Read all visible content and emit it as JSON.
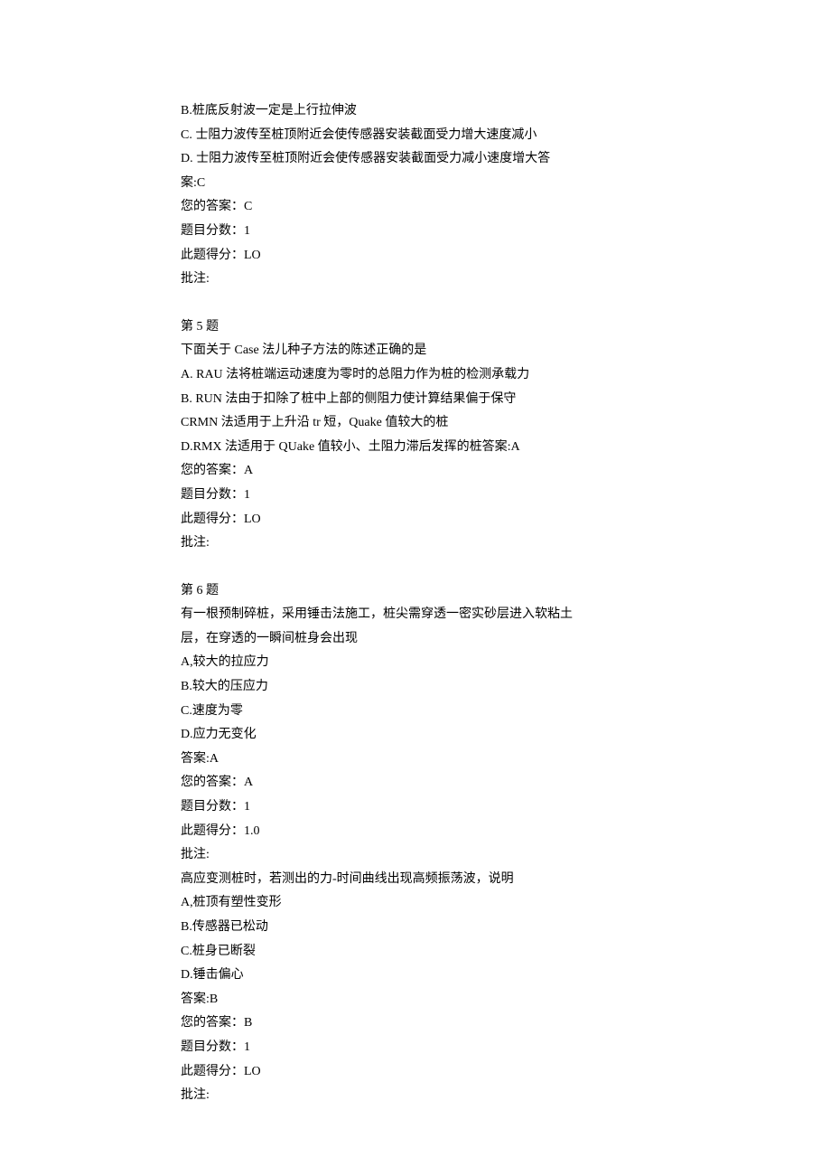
{
  "q4": {
    "optB": "B.桩底反射波一定是上行拉伸波",
    "optC": "C.   士阻力波传至桩顶附近会使传感器安装截面受力增大速度减小",
    "optD": "D.   士阻力波传至桩顶附近会使传感器安装截面受力减小速度增大答",
    "ans_label": "案:C",
    "your_answer": "您的答案：C",
    "score_label": "题目分数：1",
    "got_label": "此题得分：LO",
    "note_label": "批注:"
  },
  "q5": {
    "header": "第 5 题",
    "stem": "下面关于 Case 法儿种子方法的陈述正确的是",
    "optA": "A.   RAU 法将桩端运动速度为零时的总阻力作为桩的检测承载力",
    "optB": "B.   RUN 法由于扣除了桩中上部的侧阻力使计算结果偏于保守",
    "optC": "CRMN 法适用于上升沿 tr 短，Quake 值较大的桩",
    "optD": "D.RMX 法适用于 QUake 值较小、土阻力滞后发挥的桩答案:A",
    "your_answer": "您的答案：A",
    "score_label": "题目分数：1",
    "got_label": "此题得分：LO",
    "note_label": "批注:"
  },
  "q6": {
    "header": "第 6 题",
    "stem1": "有一根预制碎桩，采用锤击法施工，桩尖需穿透一密实砂层进入软粘土",
    "stem2": "层，在穿透的一瞬间桩身会出现",
    "optA": "A,较大的拉应力",
    "optB": "B.较大的压应力",
    "optC": "C.速度为零",
    "optD": "D.应力无变化",
    "ans": "答案:A",
    "your_answer": "您的答案：A",
    "score_label": "题目分数：1",
    "got_label": "此题得分：1.0",
    "note_label": "批注:"
  },
  "q7": {
    "stem": "高应变测桩时，若测出的力-时间曲线出现高频振荡波，说明",
    "optA": "A,桩顶有塑性变形",
    "optB": "B.传感器已松动",
    "optC": "C.桩身已断裂",
    "optD": "D.锤击偏心",
    "ans": "答案:B",
    "your_answer": "您的答案：B",
    "score_label": "题目分数：1",
    "got_label": "此题得分：LO",
    "note_label": "批注:"
  }
}
